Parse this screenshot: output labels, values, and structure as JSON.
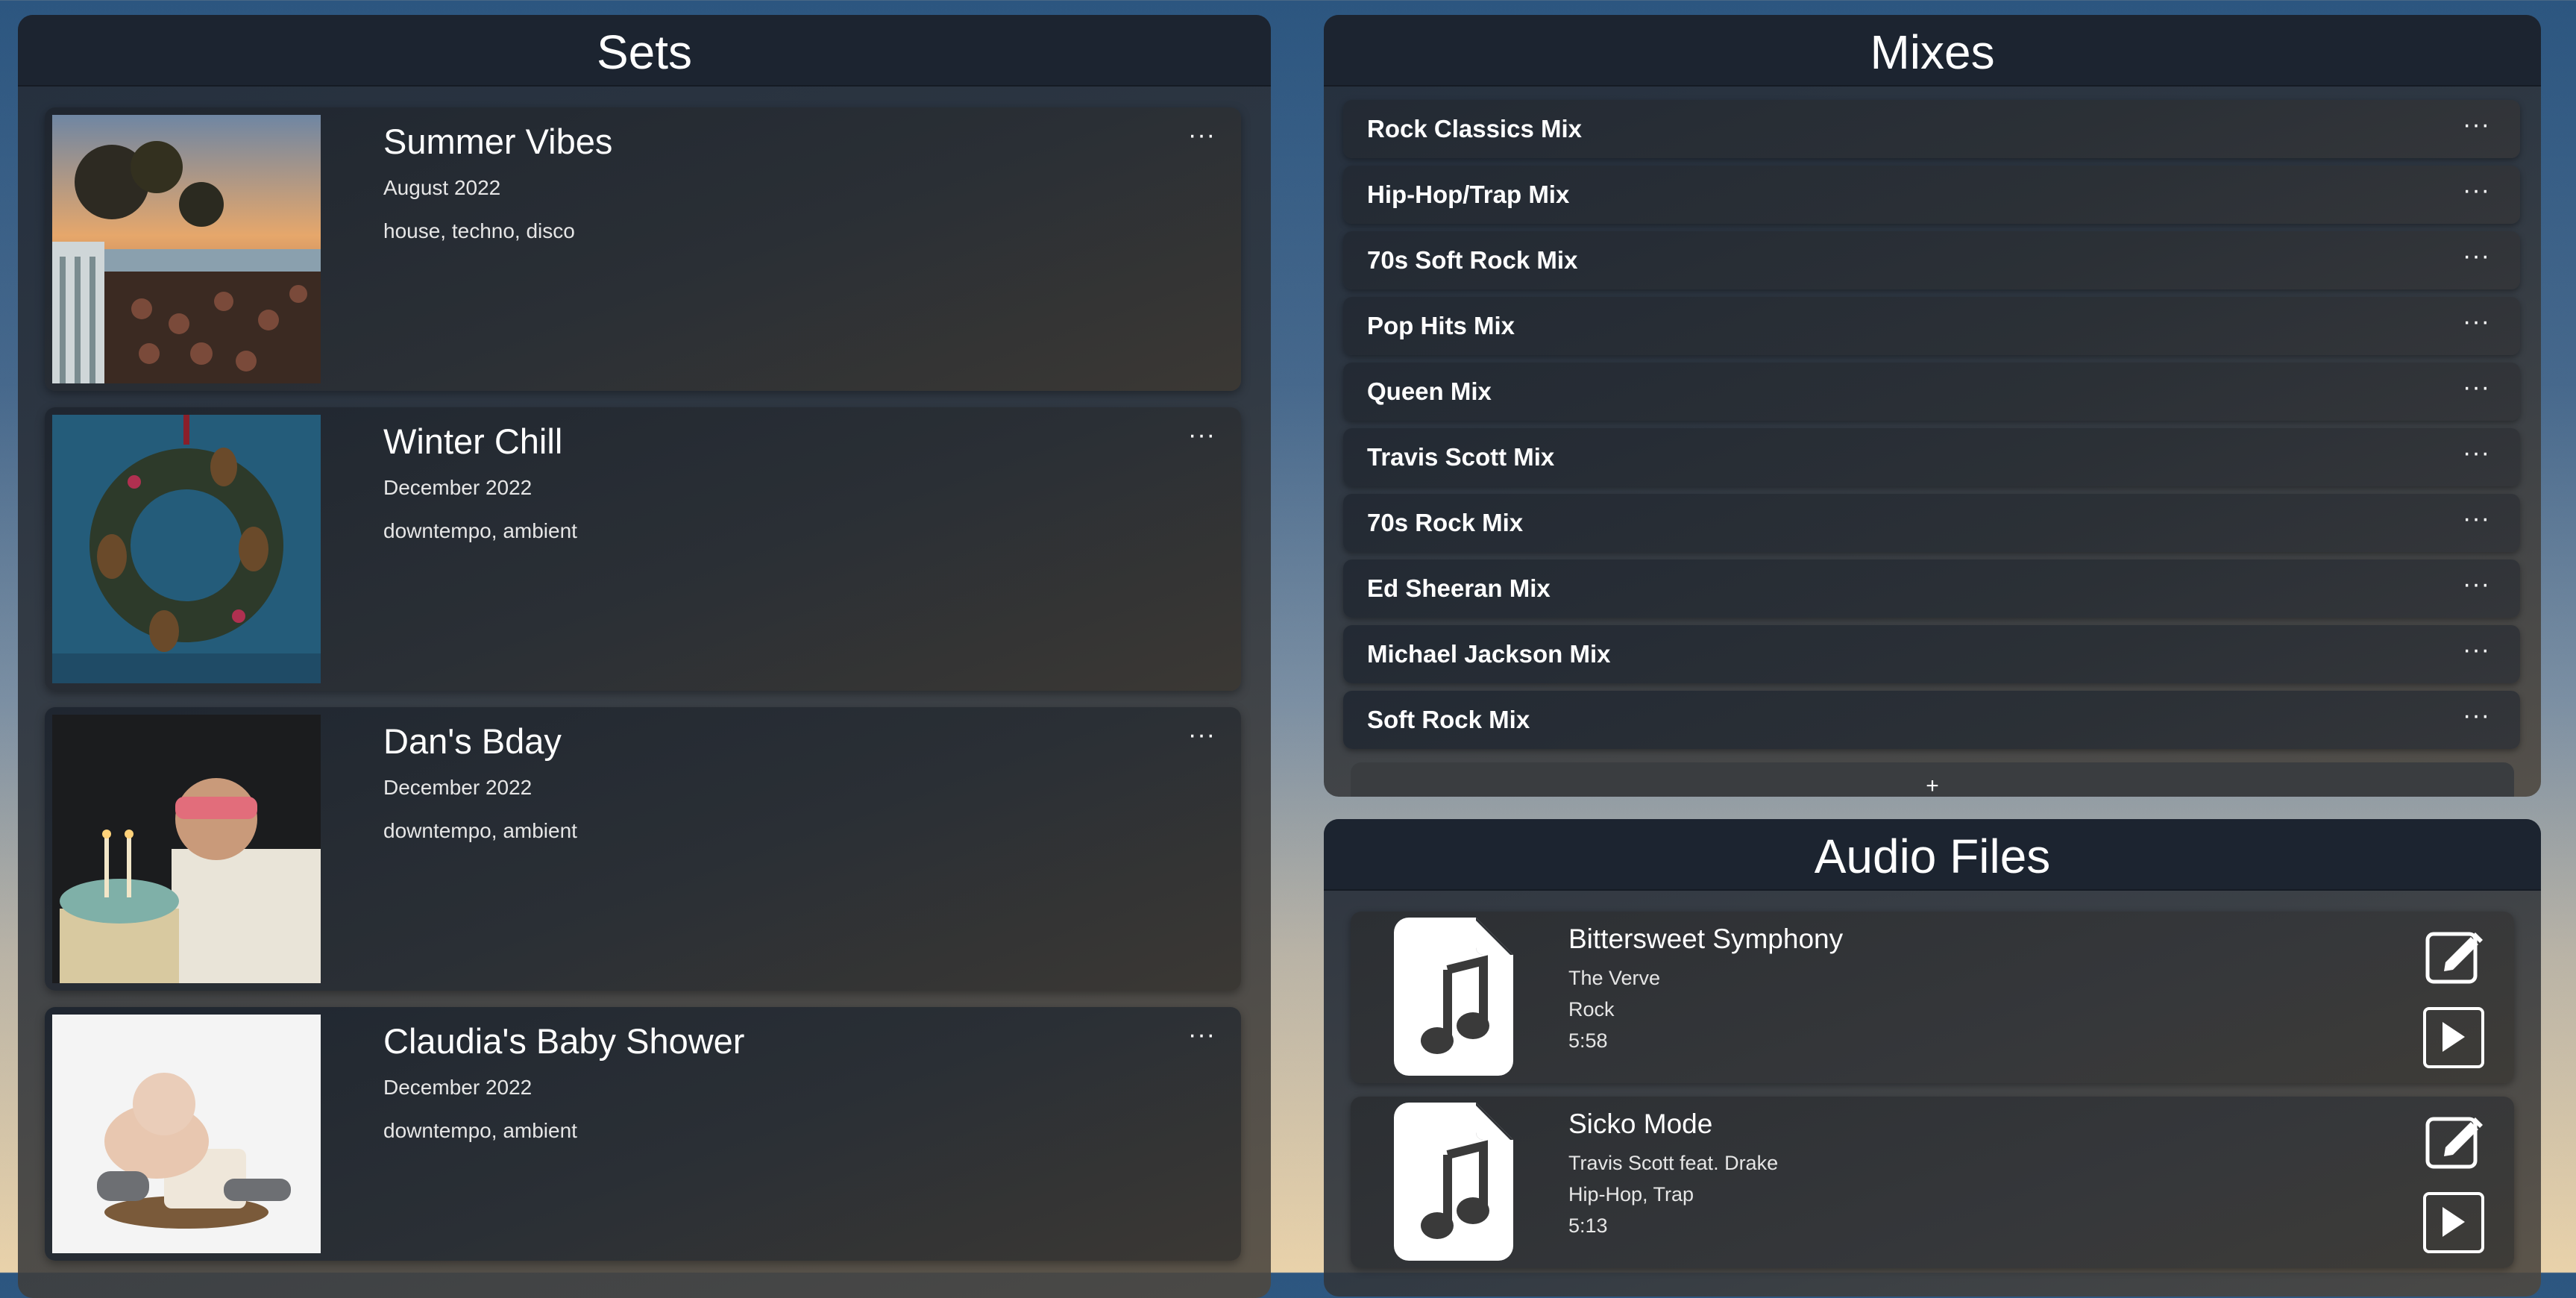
{
  "sets": {
    "title": "Sets",
    "items": [
      {
        "title": "Summer Vibes",
        "date": "August 2022",
        "tags": "house, techno, disco"
      },
      {
        "title": "Winter Chill",
        "date": "December 2022",
        "tags": "downtempo, ambient"
      },
      {
        "title": "Dan's Bday",
        "date": "December 2022",
        "tags": "downtempo, ambient"
      },
      {
        "title": "Claudia's Baby Shower",
        "date": "December 2022",
        "tags": "downtempo, ambient"
      }
    ],
    "menu_glyph": "···"
  },
  "mixes": {
    "title": "Mixes",
    "items": [
      {
        "label": "Rock Classics Mix"
      },
      {
        "label": "Hip-Hop/Trap Mix"
      },
      {
        "label": "70s Soft Rock Mix"
      },
      {
        "label": "Pop Hits Mix"
      },
      {
        "label": "Queen Mix"
      },
      {
        "label": "Travis Scott Mix"
      },
      {
        "label": "70s Rock Mix"
      },
      {
        "label": "Ed Sheeran Mix"
      },
      {
        "label": "Michael Jackson Mix"
      },
      {
        "label": "Soft Rock Mix"
      }
    ],
    "add_label": "+"
  },
  "audio": {
    "title": "Audio Files",
    "items": [
      {
        "title": "Bittersweet Symphony",
        "artist": "The Verve",
        "genre": "Rock",
        "duration": "5:58"
      },
      {
        "title": "Sicko Mode",
        "artist": "Travis Scott feat. Drake",
        "genre": "Hip-Hop, Trap",
        "duration": "5:13"
      }
    ]
  },
  "icons": {
    "file": "music-file-icon",
    "edit": "edit-icon",
    "play": "play-icon",
    "menu": "more-dots-icon"
  }
}
